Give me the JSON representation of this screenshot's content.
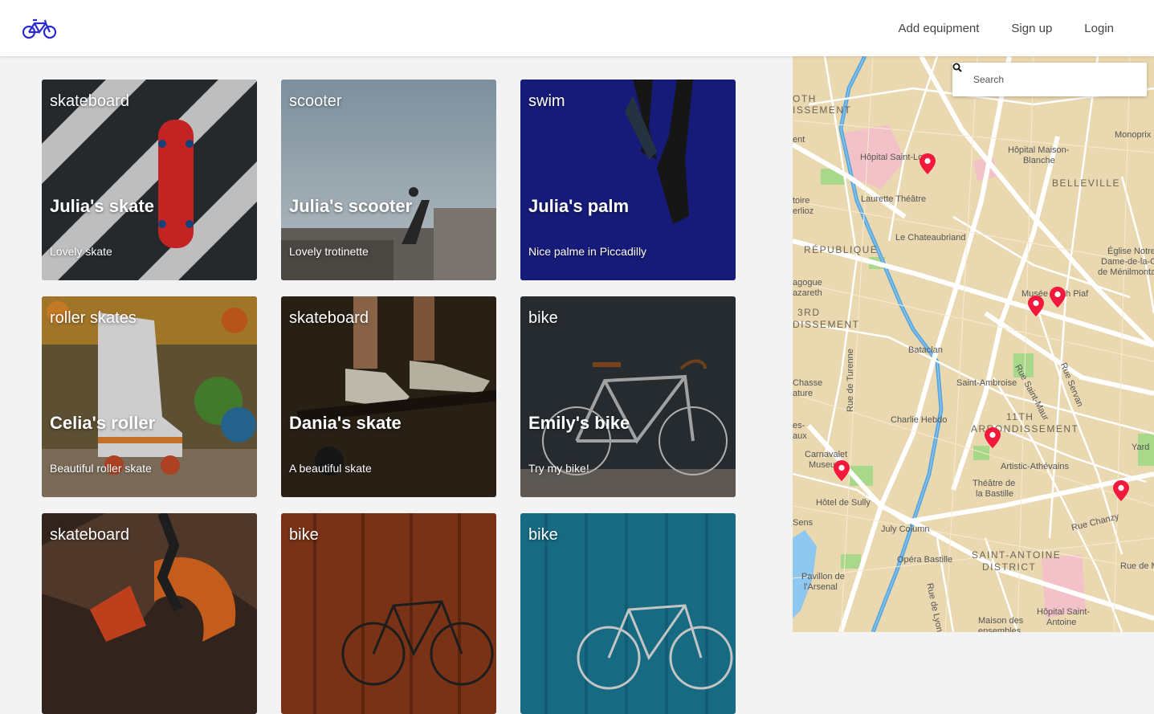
{
  "nav": {
    "links": [
      "Add equipment",
      "Sign up",
      "Login"
    ]
  },
  "cards": [
    {
      "category": "skateboard",
      "title": "Julia's skate",
      "desc": "Lovely skate"
    },
    {
      "category": "scooter",
      "title": "Julia's scooter",
      "desc": "Lovely trotinette"
    },
    {
      "category": "swim",
      "title": "Julia's palm",
      "desc": "Nice palme in Piccadilly"
    },
    {
      "category": "roller skates",
      "title": "Celia's roller",
      "desc": "Beautiful roller skate"
    },
    {
      "category": "skateboard",
      "title": "Dania's skate",
      "desc": "A beautiful skate"
    },
    {
      "category": "bike",
      "title": "Emily's bike",
      "desc": "Try my bike!"
    },
    {
      "category": "skateboard",
      "title": "",
      "desc": ""
    },
    {
      "category": "bike",
      "title": "",
      "desc": ""
    },
    {
      "category": "bike",
      "title": "",
      "desc": ""
    }
  ],
  "map": {
    "search_placeholder": "Search",
    "labels": [
      "OTH",
      "ISSEMENT",
      "ent",
      "Hôpital Saint-Louis",
      "Laurette Théâtre",
      "Le Chateaubriand",
      "Hôpital Maison-",
      "Blanche",
      "BELLEVILLE",
      "Monoprix",
      "toire",
      "erlioz",
      "RÉPUBLIQUE",
      "Église Notre-",
      "Dame-de-la-Croix",
      "de Ménilmontant",
      "agogue",
      "azareth",
      "3RD",
      "DISSEMENT",
      "Musée Edith Piaf",
      "Bataclan",
      "Rue Saint-Maur",
      "Rue Servan",
      "Chasse",
      "ature",
      "Saint-Ambroise",
      "Rue de Turenne",
      "Charlie Hebdo",
      "11TH",
      "ARRONDISSEMENT",
      "es-",
      "aux",
      "Yard",
      "Carnavalet",
      "Museum",
      "Artistic-Athévains",
      "Théâtre de",
      "la Bastille",
      "Hôtel de Sully",
      "Sens",
      "July Column",
      "Rue Chanzy",
      "Opéra Bastille",
      "SAINT-ANTOINE",
      "DISTRICT",
      "Rue de Mo",
      "Pavillon de",
      "l'Arsenal",
      "Rue de Lyon",
      "Maison des",
      "ensembles",
      "Hôpital Saint-",
      "Antoine"
    ]
  },
  "colors": {
    "accent": "#2a2ad0",
    "pin": "#f2193c",
    "map_bg": "#ead8b0",
    "water": "#5aa8e0",
    "park": "#a8d88a"
  }
}
